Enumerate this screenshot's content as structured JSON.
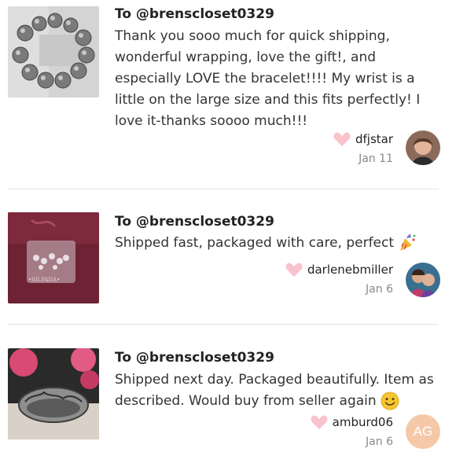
{
  "notes": [
    {
      "to": "To @brenscloset0329",
      "message": "Thank you sooo much for quick shipping, wonderful wrapping, love the gift!, and especially LOVE the bracelet!!!! My wrist is a little on the large size and this fits perfectly! I love it-thanks soooo much!!!",
      "user": "dfjstar",
      "date": "Jan 11",
      "image": "silver-bead-bracelet-photo",
      "avatar": "user-photo"
    },
    {
      "to": "To @brenscloset0329",
      "message": "Shipped fast, packaged with care, perfect",
      "message_emoji": "party-popper-emoji",
      "user": "darlenebmiller",
      "date": "Jan 6",
      "image": "silpada-pouch-photo",
      "pouch_text": "•SILPADA•",
      "avatar": "user-photo"
    },
    {
      "to": "To @brenscloset0329",
      "message": "Shipped next day. Packaged beautifully. Item as described. Would buy from seller again",
      "message_emoji": "smiling-face-emoji",
      "user": "amburd06",
      "date": "Jan 6",
      "image": "silver-ring-photo",
      "avatar_initials": "AG"
    }
  ],
  "colors": {
    "heart": "#f9c3cc",
    "divider": "#e3e3e3",
    "date": "#888888",
    "avatar_bg": "#f5c9a8"
  }
}
